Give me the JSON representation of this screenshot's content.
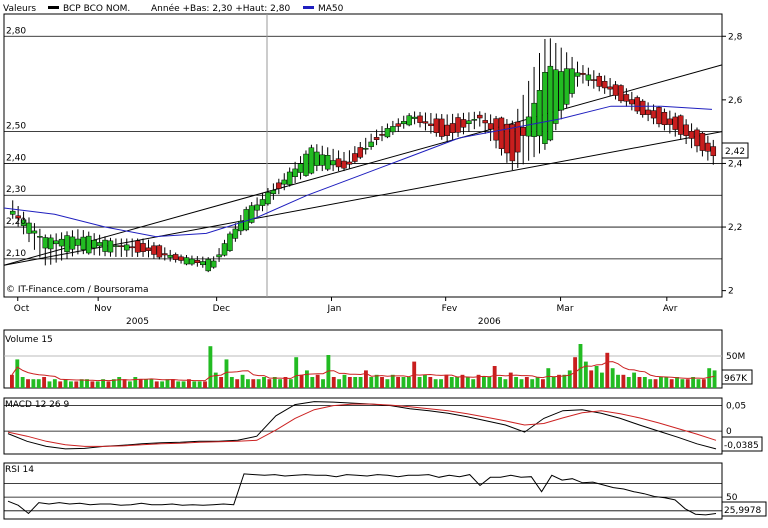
{
  "legend": {
    "label": "Valeurs",
    "series_name": "BCP BCO NOM.",
    "range_text": "Année +Bas: 2,30 +Haut: 2,80",
    "ma_name": "MA50",
    "ma_color": "#1f1fbf"
  },
  "credit": "© IT-Finance.com / Boursorama",
  "colors": {
    "up": "#22bb22",
    "down": "#c81e1e",
    "ma": "#1f1fbf",
    "signal": "#cc2222"
  },
  "chart_data": [
    {
      "type": "candlestick",
      "title": "",
      "ylim": [
        1.98,
        2.87
      ],
      "y_left_ticks": [
        "2,80",
        "2,50",
        "2,40",
        "2,30",
        "2,20",
        "2,10"
      ],
      "y_right_ticks": [
        "2,8",
        "2,6",
        "2,4",
        "2,2",
        "2"
      ],
      "y_right_values": [
        2.8,
        2.6,
        2.4,
        2.2,
        2.0
      ],
      "x_month_labels": [
        "Oct",
        "Nov",
        "Dec",
        "Jan",
        "Fev",
        "Mar",
        "Avr"
      ],
      "x_year_labels": [
        "2005",
        "2006"
      ],
      "last_value_label": "2,42",
      "grid": true,
      "ohlc_sample": [
        [
          2.24,
          2.25,
          2.28,
          2.23
        ],
        [
          2.14,
          2.16,
          2.17,
          2.08
        ],
        [
          2.13,
          2.17,
          2.19,
          2.12
        ],
        [
          2.13,
          2.15,
          2.16,
          2.11
        ],
        [
          2.15,
          2.12,
          2.16,
          2.11
        ],
        [
          2.1,
          2.1,
          2.11,
          2.09
        ],
        [
          2.07,
          2.09,
          2.1,
          2.07
        ],
        [
          2.2,
          2.25,
          2.26,
          2.2
        ],
        [
          2.33,
          2.33,
          2.35,
          2.31
        ],
        [
          2.38,
          2.45,
          2.46,
          2.38
        ],
        [
          2.41,
          2.38,
          2.43,
          2.38
        ],
        [
          2.48,
          2.49,
          2.51,
          2.47
        ],
        [
          2.54,
          2.55,
          2.56,
          2.53
        ],
        [
          2.53,
          2.48,
          2.55,
          2.47
        ],
        [
          2.54,
          2.55,
          2.56,
          2.52
        ],
        [
          2.53,
          2.4,
          2.53,
          2.38
        ],
        [
          2.46,
          2.7,
          2.8,
          2.45
        ],
        [
          2.68,
          2.69,
          2.71,
          2.66
        ],
        [
          2.65,
          2.62,
          2.66,
          2.61
        ],
        [
          2.58,
          2.55,
          2.59,
          2.54
        ],
        [
          2.54,
          2.5,
          2.55,
          2.48
        ],
        [
          2.46,
          2.42,
          2.47,
          2.4
        ]
      ],
      "ma50": [
        2.26,
        2.24,
        2.2,
        2.17,
        2.18,
        2.23,
        2.3,
        2.36,
        2.42,
        2.48,
        2.51,
        2.54,
        2.58,
        2.58,
        2.57
      ],
      "trend_lines": [
        {
          "from": [
            0.0,
            2.08
          ],
          "to": [
            1.0,
            2.71
          ]
        },
        {
          "from": [
            0.0,
            2.08
          ],
          "to": [
            1.0,
            2.5
          ]
        }
      ]
    },
    {
      "type": "bar",
      "title": "Volume 15",
      "y_ticks": [
        "50M"
      ],
      "last_value_label": "967K",
      "values_relative": [
        0.3,
        0.65,
        0.25,
        0.2,
        0.2,
        0.2,
        0.25,
        0.15,
        0.2,
        0.15,
        0.2,
        0.15,
        0.15,
        0.2,
        0.2,
        0.15,
        0.15,
        0.2,
        0.15,
        0.2,
        0.25,
        0.2,
        0.15,
        0.25,
        0.2,
        0.2,
        0.2,
        0.15,
        0.15,
        0.2,
        0.2,
        0.15,
        0.15,
        0.2,
        0.15,
        0.15,
        0.15,
        0.95,
        0.35,
        0.25,
        0.65,
        0.25,
        0.2,
        0.3,
        0.2,
        0.2,
        0.2,
        0.25,
        0.2,
        0.25,
        0.2,
        0.25,
        0.2,
        0.7,
        0.3,
        0.4,
        0.25,
        0.3,
        0.2,
        0.75,
        0.25,
        0.2,
        0.3,
        0.25,
        0.25,
        0.25,
        0.4,
        0.25,
        0.3,
        0.25,
        0.2,
        0.3,
        0.25,
        0.25,
        0.25,
        0.6,
        0.25,
        0.3,
        0.25,
        0.2,
        0.2,
        0.3,
        0.25,
        0.25,
        0.3,
        0.25,
        0.2,
        0.3,
        0.25,
        0.25,
        0.5,
        0.25,
        0.2,
        0.35,
        0.25,
        0.2,
        0.25,
        0.2,
        0.25,
        0.2,
        0.45,
        0.25,
        0.3,
        0.3,
        0.4,
        0.7,
        1.0,
        0.6,
        0.4,
        0.5,
        0.35,
        0.8,
        0.45,
        0.3,
        0.3,
        0.25,
        0.35,
        0.25,
        0.25,
        0.2,
        0.2,
        0.25,
        0.25,
        0.2,
        0.25,
        0.2,
        0.2,
        0.25,
        0.2,
        0.2,
        0.45,
        0.4
      ]
    },
    {
      "type": "line",
      "title": "MACD 12 26 9",
      "y_ticks": [
        "0,05",
        "0"
      ],
      "y_values": [
        0.05,
        0.0
      ],
      "ylim": [
        -0.045,
        0.065
      ],
      "last_value_label": "-0,0385",
      "macd": [
        -0.005,
        -0.02,
        -0.03,
        -0.035,
        -0.034,
        -0.03,
        -0.028,
        -0.025,
        -0.023,
        -0.022,
        -0.02,
        -0.02,
        -0.018,
        -0.01,
        0.03,
        0.052,
        0.058,
        0.057,
        0.055,
        0.053,
        0.05,
        0.044,
        0.04,
        0.035,
        0.028,
        0.02,
        0.012,
        -0.002,
        0.025,
        0.04,
        0.042,
        0.035,
        0.025,
        0.012,
        0.0,
        -0.012,
        -0.025,
        -0.035
      ],
      "signal": [
        -0.002,
        -0.01,
        -0.02,
        -0.027,
        -0.03,
        -0.03,
        -0.029,
        -0.027,
        -0.025,
        -0.024,
        -0.022,
        -0.021,
        -0.02,
        -0.018,
        0.002,
        0.025,
        0.042,
        0.05,
        0.053,
        0.053,
        0.051,
        0.048,
        0.044,
        0.04,
        0.034,
        0.027,
        0.02,
        0.012,
        0.015,
        0.026,
        0.036,
        0.04,
        0.034,
        0.026,
        0.016,
        0.005,
        -0.006,
        -0.018
      ]
    },
    {
      "type": "line",
      "title": "RSI 14",
      "y_ticks": [
        "50"
      ],
      "y_values": [
        50
      ],
      "ylim": [
        18,
        100
      ],
      "last_value_label": "25,9978",
      "rsi": [
        44,
        38,
        26,
        42,
        40,
        42,
        40,
        41,
        39,
        40,
        40,
        38,
        39,
        41,
        39,
        39,
        40,
        38,
        39,
        38,
        39,
        40,
        39,
        84,
        83,
        82,
        83,
        81,
        82,
        83,
        82,
        82,
        80,
        83,
        82,
        81,
        83,
        82,
        80,
        82,
        82,
        83,
        79,
        82,
        80,
        83,
        67,
        79,
        79,
        82,
        79,
        80,
        58,
        82,
        75,
        77,
        71,
        72,
        68,
        64,
        62,
        58,
        55,
        51,
        49,
        46,
        33,
        25,
        24,
        26
      ]
    }
  ]
}
